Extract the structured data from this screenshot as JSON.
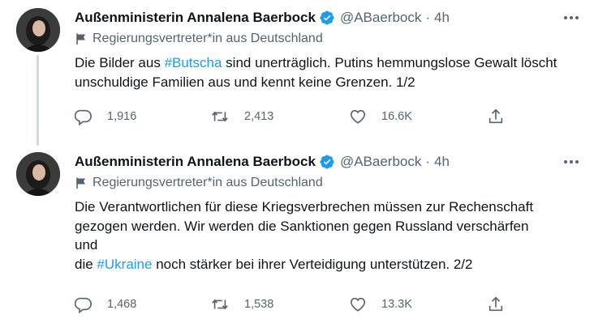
{
  "tweets": [
    {
      "author_name": "Außenministerin Annalena Baerbock",
      "handle": "@ABaerbock",
      "separator": "·",
      "time": "4h",
      "label": "Regierungsvertreter*in aus Deutschland",
      "text_before": "Die Bilder aus ",
      "hashtag": "#Butscha",
      "text_after": " sind unerträglich. Putins hemmungslose Gewalt löscht unschuldige Familien aus und kennt keine Grenzen. 1/2",
      "replies": "1,916",
      "retweets": "2,413",
      "likes": "16.6K"
    },
    {
      "author_name": "Außenministerin Annalena Baerbock",
      "handle": "@ABaerbock",
      "separator": "·",
      "time": "4h",
      "label": "Regierungsvertreter*in aus Deutschland",
      "line1": "Die Verantwortlichen für diese Kriegsverbrechen müssen zur Rechenschaft",
      "line2": "gezogen werden. Wir werden die Sanktionen gegen Russland verschärfen",
      "line3": "und",
      "line4_before": "die ",
      "hashtag": "#Ukraine",
      "line4_after": " noch stärker bei ihrer Verteidigung unterstützen. 2/2",
      "replies": "1,468",
      "retweets": "1,538",
      "likes": "13.3K"
    }
  ],
  "icons": {
    "verified": "verified-badge-icon",
    "flag": "flag-icon",
    "more": "more-dots-icon",
    "reply": "reply-icon",
    "retweet": "retweet-icon",
    "like": "like-icon",
    "share": "share-icon"
  },
  "colors": {
    "accent": "#1d9bf0",
    "secondary_text": "#536471",
    "thread_line": "#cfd9de"
  }
}
